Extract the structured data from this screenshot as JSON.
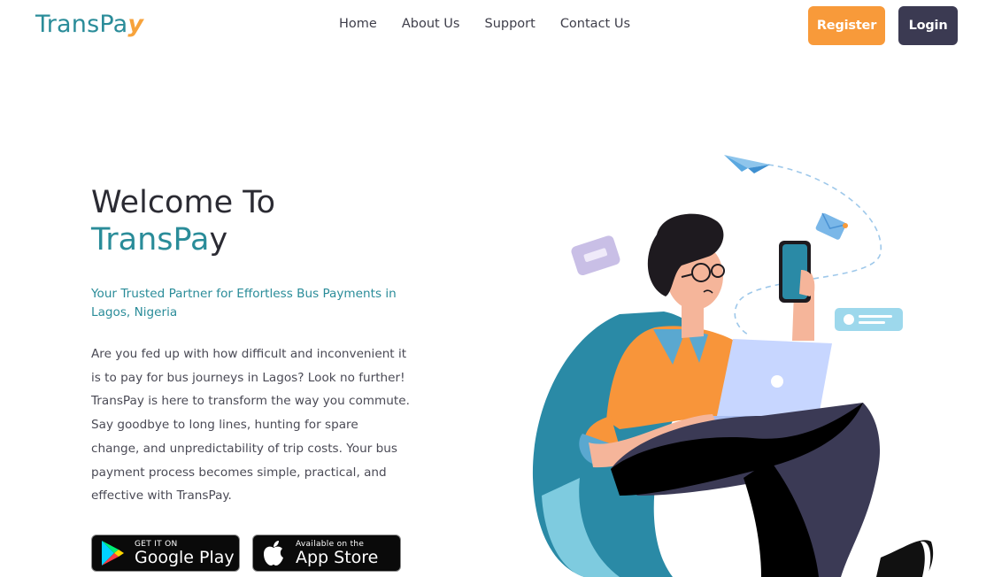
{
  "header": {
    "logo_main": "TransPa",
    "logo_accent": "y",
    "nav": [
      "Home",
      "About Us",
      "Support",
      "Contact Us"
    ],
    "register_label": "Register",
    "login_label": "Login"
  },
  "hero": {
    "title_line1": "Welcome To",
    "title_brand_main": "TransPa",
    "title_brand_end": "y",
    "subtitle": "Your Trusted Partner for Effortless Bus Payments in Lagos, Nigeria",
    "description": "Are you fed up with how difficult and inconvenient it is to pay for bus journeys in Lagos? Look no further! TransPay is here to transform the way you commute. Say goodbye to long lines, hunting for spare change, and unpredictability of trip costs. Your bus payment process becomes simple, practical, and effective with TransPay."
  },
  "stores": {
    "google_small": "GET IT ON",
    "google_big": "Google Play",
    "apple_small": "Available on the",
    "apple_big": "App Store"
  },
  "icons": {
    "google_play": "google-play-icon",
    "apple": "apple-icon",
    "paper_plane": "paper-plane-icon",
    "envelope": "envelope-icon",
    "message": "message-icon"
  },
  "colors": {
    "brand_teal": "#2a8c99",
    "brand_orange": "#f89a3a",
    "login_dark": "#3b3a52",
    "chair_blue": "#2e8ea9",
    "shirt_orange": "#f8953a",
    "pants_navy": "#3b3a55"
  }
}
